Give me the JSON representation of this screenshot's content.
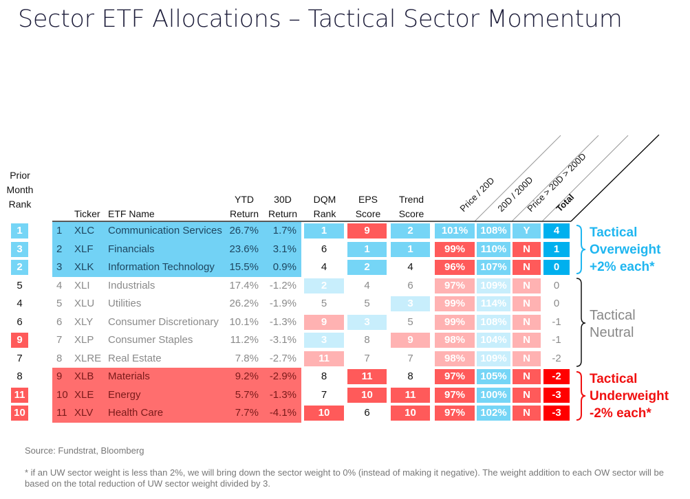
{
  "title": "Sector ETF Allocations – Tactical Sector Momentum",
  "headers": {
    "prior_rank": "Prior Month Rank",
    "ticker": "Ticker",
    "etf_name": "ETF Name",
    "ytd": "YTD Return",
    "d30": "30D Return",
    "dqm": "DQM Rank",
    "eps": "EPS Score",
    "trend": "Trend Score",
    "p20": "Price / 20D",
    "d20_200": "20D / 200D",
    "pgt": "Price > 20D > 200D",
    "total": "Total"
  },
  "colors": {
    "blue": "#75d5f6",
    "light_blue": "#c8eefc",
    "red": "#ff5a5a",
    "light_red": "#ffb2b2",
    "dark_blue": "#00b0ee",
    "dark_red": "#ff0000",
    "row_blue": "#72d2f5",
    "row_red": "#ff6e6e",
    "overweight_text": "#1fb6f0",
    "underweight_text": "#f01010",
    "neutral_text": "#888888"
  },
  "chart_data": {
    "type": "table",
    "columns": [
      "Prior Month Rank",
      "Rank",
      "Ticker",
      "ETF Name",
      "YTD Return",
      "30D Return",
      "DQM Rank",
      "EPS Score",
      "Trend Score",
      "Price / 20D",
      "20D / 200D",
      "Price > 20D > 200D",
      "Total"
    ],
    "rows": [
      {
        "group": "ow",
        "prior": "1",
        "prior_c": "b",
        "rank": "1",
        "ticker": "XLC",
        "name": "Communication Services",
        "ytd": "26.7%",
        "d30": "1.7%",
        "dqm": "1",
        "dqm_c": "b",
        "eps": "9",
        "eps_c": "r",
        "trend": "2",
        "trend_c": "b",
        "p20": "101%",
        "p20_c": "b",
        "d20": "108%",
        "d20_c": "b",
        "yn": "Y",
        "yn_c": "b",
        "total": "4",
        "total_c": "db"
      },
      {
        "group": "ow",
        "prior": "3",
        "prior_c": "b",
        "rank": "2",
        "ticker": "XLF",
        "name": "Financials",
        "ytd": "23.6%",
        "d30": "3.1%",
        "dqm": "6",
        "dqm_c": "",
        "eps": "1",
        "eps_c": "b",
        "trend": "1",
        "trend_c": "b",
        "p20": "99%",
        "p20_c": "r",
        "d20": "110%",
        "d20_c": "b",
        "yn": "N",
        "yn_c": "r",
        "total": "1",
        "total_c": "db"
      },
      {
        "group": "ow",
        "prior": "2",
        "prior_c": "b",
        "rank": "3",
        "ticker": "XLK",
        "name": "Information Technology",
        "ytd": "15.5%",
        "d30": "0.9%",
        "dqm": "4",
        "dqm_c": "",
        "eps": "2",
        "eps_c": "b",
        "trend": "4",
        "trend_c": "",
        "p20": "96%",
        "p20_c": "r",
        "d20": "107%",
        "d20_c": "b",
        "yn": "N",
        "yn_c": "r",
        "total": "0",
        "total_c": "db"
      },
      {
        "group": "n",
        "prior": "5",
        "prior_c": "",
        "rank": "4",
        "ticker": "XLI",
        "name": "Industrials",
        "ytd": "17.4%",
        "d30": "-1.2%",
        "dqm": "2",
        "dqm_c": "lb",
        "eps": "4",
        "eps_c": "",
        "trend": "6",
        "trend_c": "",
        "p20": "97%",
        "p20_c": "lr",
        "d20": "109%",
        "d20_c": "lb",
        "yn": "N",
        "yn_c": "lr",
        "total": "0",
        "total_c": ""
      },
      {
        "group": "n",
        "prior": "4",
        "prior_c": "",
        "rank": "5",
        "ticker": "XLU",
        "name": "Utilities",
        "ytd": "26.2%",
        "d30": "-1.9%",
        "dqm": "5",
        "dqm_c": "",
        "eps": "5",
        "eps_c": "",
        "trend": "3",
        "trend_c": "lb",
        "p20": "99%",
        "p20_c": "lr",
        "d20": "114%",
        "d20_c": "lb",
        "yn": "N",
        "yn_c": "lr",
        "total": "0",
        "total_c": ""
      },
      {
        "group": "n",
        "prior": "6",
        "prior_c": "",
        "rank": "6",
        "ticker": "XLY",
        "name": "Consumer Discretionary",
        "ytd": "10.1%",
        "d30": "-1.3%",
        "dqm": "9",
        "dqm_c": "lr",
        "eps": "3",
        "eps_c": "lb",
        "trend": "5",
        "trend_c": "",
        "p20": "99%",
        "p20_c": "lr",
        "d20": "108%",
        "d20_c": "lb",
        "yn": "N",
        "yn_c": "lr",
        "total": "-1",
        "total_c": ""
      },
      {
        "group": "n",
        "prior": "9",
        "prior_c": "r",
        "rank": "7",
        "ticker": "XLP",
        "name": "Consumer Staples",
        "ytd": "11.2%",
        "d30": "-3.1%",
        "dqm": "3",
        "dqm_c": "lb",
        "eps": "8",
        "eps_c": "",
        "trend": "9",
        "trend_c": "lr",
        "p20": "98%",
        "p20_c": "lr",
        "d20": "104%",
        "d20_c": "lb",
        "yn": "N",
        "yn_c": "lr",
        "total": "-1",
        "total_c": ""
      },
      {
        "group": "n",
        "prior": "7",
        "prior_c": "",
        "rank": "8",
        "ticker": "XLRE",
        "name": "Real Estate",
        "ytd": "7.8%",
        "d30": "-2.7%",
        "dqm": "11",
        "dqm_c": "lr",
        "eps": "7",
        "eps_c": "",
        "trend": "7",
        "trend_c": "",
        "p20": "98%",
        "p20_c": "lr",
        "d20": "109%",
        "d20_c": "lb",
        "yn": "N",
        "yn_c": "lr",
        "total": "-2",
        "total_c": ""
      },
      {
        "group": "uw",
        "prior": "8",
        "prior_c": "",
        "rank": "9",
        "ticker": "XLB",
        "name": "Materials",
        "ytd": "9.2%",
        "d30": "-2.9%",
        "dqm": "8",
        "dqm_c": "",
        "eps": "11",
        "eps_c": "r",
        "trend": "8",
        "trend_c": "",
        "p20": "97%",
        "p20_c": "r",
        "d20": "105%",
        "d20_c": "b",
        "yn": "N",
        "yn_c": "r",
        "total": "-2",
        "total_c": "dr"
      },
      {
        "group": "uw",
        "prior": "11",
        "prior_c": "r",
        "rank": "10",
        "ticker": "XLE",
        "name": "Energy",
        "ytd": "5.7%",
        "d30": "-1.3%",
        "dqm": "7",
        "dqm_c": "",
        "eps": "10",
        "eps_c": "r",
        "trend": "11",
        "trend_c": "r",
        "p20": "97%",
        "p20_c": "r",
        "d20": "100%",
        "d20_c": "b",
        "yn": "N",
        "yn_c": "r",
        "total": "-3",
        "total_c": "dr"
      },
      {
        "group": "uw",
        "prior": "10",
        "prior_c": "r",
        "rank": "11",
        "ticker": "XLV",
        "name": "Health Care",
        "ytd": "7.7%",
        "d30": "-4.1%",
        "dqm": "10",
        "dqm_c": "r",
        "eps": "6",
        "eps_c": "",
        "trend": "10",
        "trend_c": "r",
        "p20": "97%",
        "p20_c": "r",
        "d20": "102%",
        "d20_c": "b",
        "yn": "N",
        "yn_c": "r",
        "total": "-3",
        "total_c": "dr"
      }
    ]
  },
  "groups": {
    "overweight": [
      "Tactical",
      "Overweight",
      "+2% each*"
    ],
    "neutral": [
      "Tactical",
      "Neutral"
    ],
    "underweight": [
      "Tactical",
      "Underweight",
      "-2% each*"
    ]
  },
  "source": "Source: Fundstrat, Bloomberg",
  "footnote": "* if an UW sector weight is less than 2%, we will bring down the sector weight to 0% (instead of making it negative). The weight addition to each OW sector will be based on the total reduction of UW sector weight divided by 3."
}
